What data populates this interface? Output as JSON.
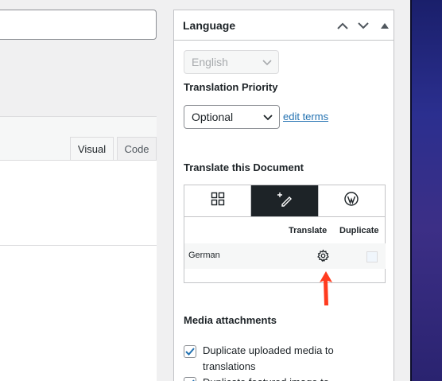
{
  "editor": {
    "tabs": [
      {
        "label": "Visual"
      },
      {
        "label": "Code"
      }
    ]
  },
  "panel": {
    "title": "Language",
    "language_select": {
      "value": "English"
    },
    "priority": {
      "label": "Translation Priority",
      "value": "Optional",
      "edit_terms": "edit terms"
    },
    "translate_section": {
      "label": "Translate this Document",
      "tabs": [
        {
          "icon": "grid-icon",
          "active": false
        },
        {
          "icon": "add-edit-translation-icon",
          "active": true
        },
        {
          "icon": "wordpress-icon",
          "active": false
        }
      ],
      "table": {
        "headers": {
          "translate": "Translate",
          "duplicate": "Duplicate"
        },
        "rows": [
          {
            "language": "German"
          }
        ]
      }
    },
    "media": {
      "label": "Media attachments",
      "options": [
        {
          "label": "Duplicate uploaded media to translations",
          "checked": true
        },
        {
          "label": "Duplicate featured image to",
          "checked": true
        }
      ]
    }
  },
  "colors": {
    "accent": "#2271b1",
    "active_tab": "#1d2327",
    "annotation_arrow": "#ff3b1f"
  }
}
